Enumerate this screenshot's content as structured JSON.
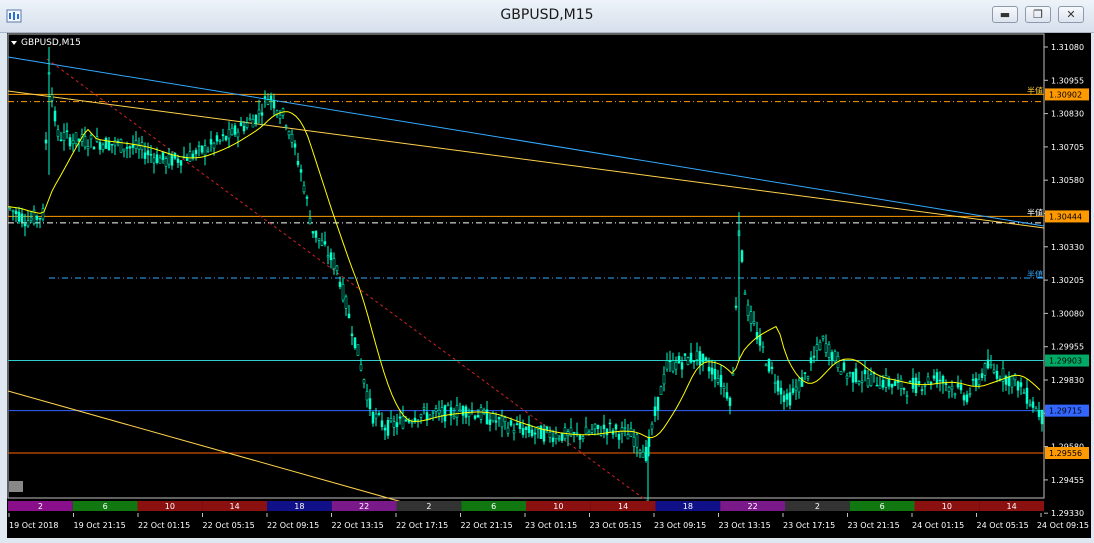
{
  "window": {
    "title": "GBPUSD,M15",
    "buttons": [
      "minimize",
      "restore",
      "close"
    ]
  },
  "chart": {
    "symbol_label": "GBPUSD,M15",
    "background": "#000000",
    "candle_color": "#00ffcc",
    "ma_color": "#ffff00",
    "price_axis": [
      "1.31080",
      "1.30955",
      "1.30830",
      "1.30705",
      "1.30580",
      "1.30455",
      "1.30330",
      "1.30205",
      "1.30080",
      "1.29955",
      "1.29830",
      "1.29705",
      "1.29580",
      "1.29455",
      "1.29330"
    ],
    "price_tags": [
      {
        "value": "1.30902",
        "color": "#ff9900"
      },
      {
        "value": "1.30444",
        "color": "#ff9900"
      },
      {
        "value": "1.29903",
        "color": "#00aa66"
      },
      {
        "value": "1.29715",
        "color": "#3366ff"
      },
      {
        "value": "1.29556",
        "color": "#ff9900"
      }
    ],
    "line_markers": [
      "半値",
      "半値",
      "半値"
    ],
    "time_axis": [
      "19 Oct 2018",
      "19 Oct 21:15",
      "22 Oct 01:15",
      "22 Oct 05:15",
      "22 Oct 09:15",
      "22 Oct 13:15",
      "22 Oct 17:15",
      "22 Oct 21:15",
      "23 Oct 01:15",
      "23 Oct 05:15",
      "23 Oct 09:15",
      "23 Oct 13:15",
      "23 Oct 17:15",
      "23 Oct 21:15",
      "24 Oct 01:15",
      "24 Oct 05:15",
      "24 Oct 09:15"
    ],
    "session_bar": [
      {
        "label": "2",
        "color": "#8a0f8a"
      },
      {
        "label": "6",
        "color": "#117711"
      },
      {
        "label": "10",
        "color": "#8b1010"
      },
      {
        "label": "14",
        "color": "#8b1010"
      },
      {
        "label": "18",
        "color": "#101088"
      },
      {
        "label": "22",
        "color": "#7a1a8a"
      },
      {
        "label": "2",
        "color": "#333333"
      },
      {
        "label": "6",
        "color": "#117711"
      },
      {
        "label": "10",
        "color": "#8b1010"
      },
      {
        "label": "14",
        "color": "#8b1010"
      },
      {
        "label": "18",
        "color": "#101088"
      },
      {
        "label": "22",
        "color": "#7a1a8a"
      },
      {
        "label": "2",
        "color": "#333333"
      },
      {
        "label": "6",
        "color": "#117711"
      },
      {
        "label": "10",
        "color": "#8b1010"
      },
      {
        "label": "14",
        "color": "#8b1010"
      }
    ]
  }
}
